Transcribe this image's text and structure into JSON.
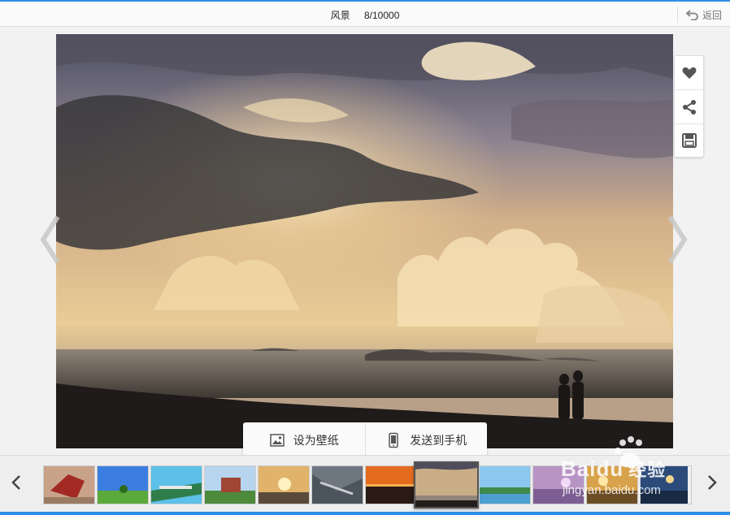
{
  "header": {
    "category": "风景",
    "counter": "8/10000",
    "back_label": "返回"
  },
  "side_tools": [
    {
      "icon": "heart-icon"
    },
    {
      "icon": "share-icon"
    },
    {
      "icon": "save-icon"
    }
  ],
  "actions": {
    "wallpaper_label": "设为壁纸",
    "send_label": "发送到手机"
  },
  "thumbnails": {
    "count": 12,
    "active_index": 7
  },
  "watermark": {
    "brand": "Baidu",
    "brand_suffix": "经验",
    "url": "jingyan.baidu.com"
  },
  "colors": {
    "accent": "#2d8ee6"
  }
}
